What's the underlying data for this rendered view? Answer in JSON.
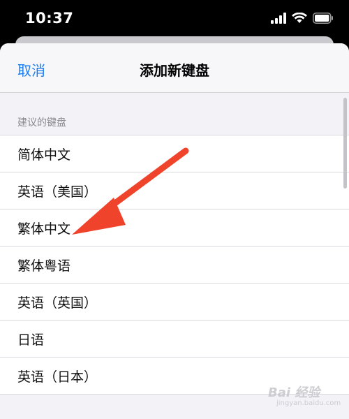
{
  "status_bar": {
    "time": "10:37",
    "icons": [
      "signal-icon",
      "wifi-icon",
      "battery-icon"
    ]
  },
  "nav": {
    "cancel_label": "取消",
    "title": "添加新键盘"
  },
  "section": {
    "header": "建议的键盘"
  },
  "keyboards": [
    {
      "label": "简体中文"
    },
    {
      "label": "英语（美国）"
    },
    {
      "label": "繁体中文"
    },
    {
      "label": "繁体粤语"
    },
    {
      "label": "英语（英国）"
    },
    {
      "label": "日语"
    },
    {
      "label": "英语（日本）"
    }
  ],
  "annotation": {
    "arrow_color": "#f0432b"
  },
  "watermark": {
    "text": "Bai 经验",
    "sub": "jingyan.baidu.com"
  },
  "colors": {
    "accent": "#1a7cf0",
    "background": "#f2f2f7"
  }
}
